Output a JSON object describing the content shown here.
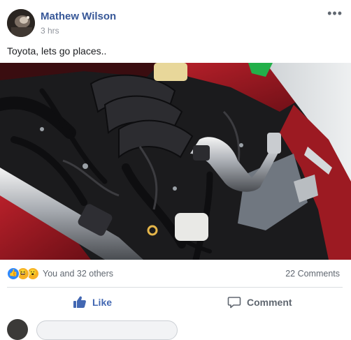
{
  "post": {
    "author": "Mathew Wilson",
    "time": "3 hrs",
    "more_label": "•••",
    "text": "Toyota, lets go places..",
    "photo_alt": "engine-bay-photo"
  },
  "reactions": {
    "icons": [
      "like-reaction-icon",
      "haha-reaction-icon",
      "wow-reaction-icon"
    ],
    "like_glyph": "👍",
    "haha_glyph": "😆",
    "wow_glyph": "😮",
    "summary": "You and 32 others",
    "comments": "22 Comments"
  },
  "actions": {
    "like_label": "Like",
    "comment_label": "Comment"
  },
  "colors": {
    "link": "#385898",
    "like_active": "#4267b2",
    "secondary_text": "#606770",
    "divider": "#dadde1"
  }
}
